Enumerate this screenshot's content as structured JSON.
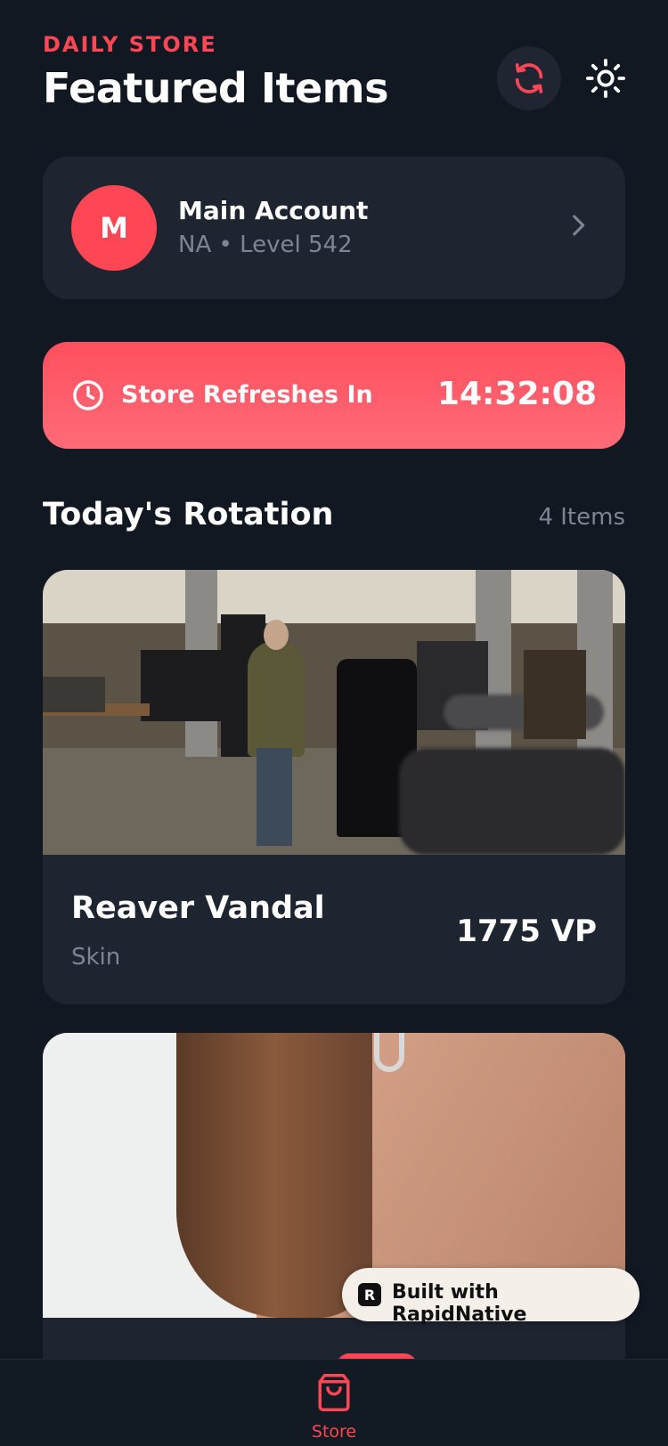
{
  "header": {
    "eyebrow": "DAILY STORE",
    "title": "Featured Items",
    "refresh_icon": "refresh-icon",
    "theme_icon": "sun-icon"
  },
  "account": {
    "initial": "M",
    "name": "Main Account",
    "subtitle": "NA • Level 542",
    "chevron_icon": "chevron-right-icon"
  },
  "timer": {
    "label": "Store Refreshes In",
    "value": "14:32:08",
    "icon": "clock-icon"
  },
  "rotation": {
    "title": "Today's Rotation",
    "count": "4 Items",
    "items": [
      {
        "name": "Reaver Vandal",
        "type": "Skin",
        "price": "1775 VP"
      },
      {
        "name": "",
        "type": "",
        "price": ""
      }
    ]
  },
  "badge": {
    "logo": "R",
    "text": "Built with RapidNative"
  },
  "tabbar": {
    "store_label": "Store",
    "store_icon": "shopping-bag-icon"
  },
  "colors": {
    "accent": "#ff4655",
    "background": "#111822",
    "card": "#1f2530",
    "muted_text": "#7d8593"
  }
}
